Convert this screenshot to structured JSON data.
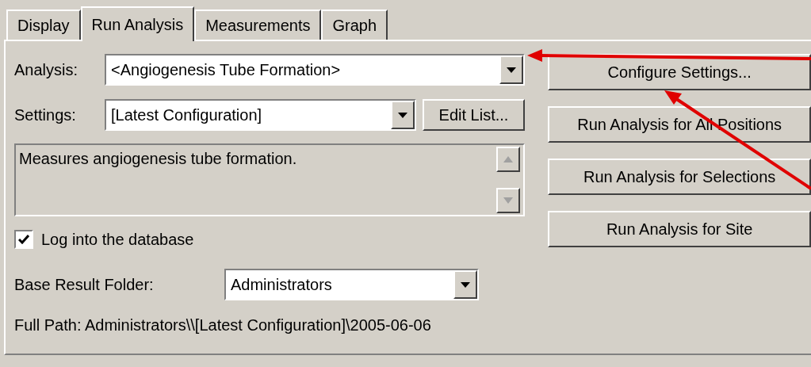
{
  "tabs": [
    {
      "label": "Display",
      "selected": false
    },
    {
      "label": "Run Analysis",
      "selected": true
    },
    {
      "label": "Measurements",
      "selected": false
    },
    {
      "label": "Graph",
      "selected": false
    }
  ],
  "analysis": {
    "label": "Analysis:",
    "value": "<Angiogenesis Tube Formation>"
  },
  "settings": {
    "label": "Settings:",
    "value": "[Latest Configuration]",
    "button": "Edit List..."
  },
  "description": "Measures angiogenesis tube formation.",
  "log_checkbox": {
    "label": "Log into the database",
    "checked": true
  },
  "base_result_folder": {
    "label": "Base Result Folder:",
    "value": "Administrators"
  },
  "full_path": "Full Path: Administrators\\\\[Latest Configuration]\\2005-06-06",
  "buttons": [
    "Configure Settings...",
    "Run Analysis for All Positions",
    "Run Analysis for Selections",
    "Run Analysis for Site"
  ]
}
